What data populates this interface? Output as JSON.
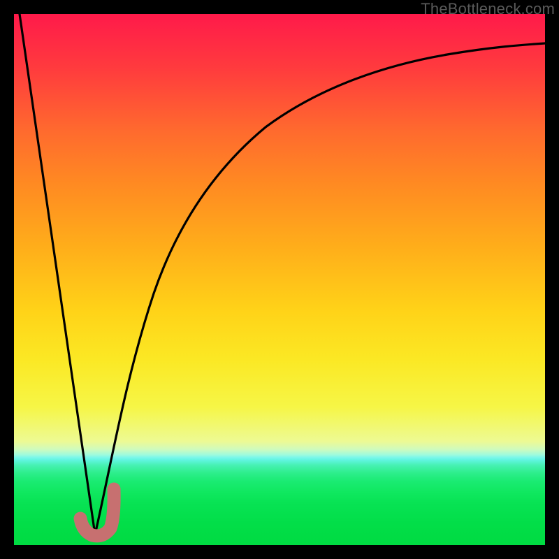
{
  "watermark": "TheBottleneck.com",
  "chart_data": {
    "type": "line",
    "title": "",
    "xlabel": "",
    "ylabel": "",
    "xlim": [
      0,
      100
    ],
    "ylim": [
      0,
      100
    ],
    "series": [
      {
        "name": "left-slope",
        "x": [
          1,
          15.3
        ],
        "y": [
          100,
          2
        ]
      },
      {
        "name": "right-curve",
        "x": [
          15.3,
          17,
          19,
          22,
          26,
          31,
          37,
          44,
          54,
          66,
          80,
          94,
          100
        ],
        "y": [
          2,
          10,
          21,
          34,
          47,
          58,
          67.5,
          75,
          81.5,
          86.7,
          90.2,
          92.4,
          93
        ]
      },
      {
        "name": "marker-j-shape",
        "x": [
          12.5,
          13.2,
          14.0,
          15.0,
          16.0,
          17.0,
          18.0,
          18.5,
          18.8
        ],
        "y": [
          5.0,
          3.5,
          2.3,
          1.8,
          1.8,
          2.3,
          4.0,
          7.0,
          10.5
        ]
      }
    ],
    "background_gradient": {
      "top": "#ff1a4a",
      "middle": "#ffd318",
      "bottom": "#00db42"
    },
    "marker_color": "#c77070",
    "curve_color": "#000000"
  }
}
